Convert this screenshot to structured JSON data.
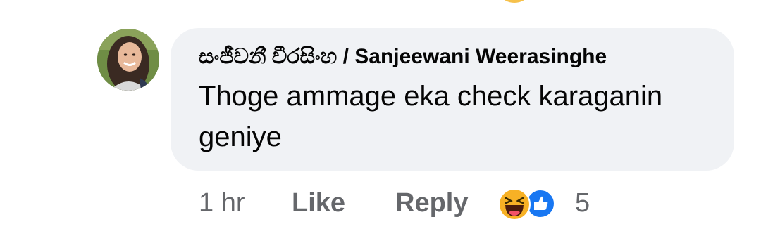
{
  "comment": {
    "author": "සංජීවනී වීරසිංහ / Sanjeewani Weerasinghe",
    "text": "Thoge ammage eka check karaganin geniye",
    "avatar_icon": "profile-photo"
  },
  "actions": {
    "time": "1 hr",
    "like_label": "Like",
    "reply_label": "Reply"
  },
  "reactions": {
    "icons": [
      "haha-reaction-icon",
      "like-reaction-icon"
    ],
    "count": "5"
  },
  "colors": {
    "bubble_bg": "#f0f2f5",
    "text_primary": "#050505",
    "text_secondary": "#65676b",
    "like_blue": "#1877f2",
    "haha_yellow": "#f7b125"
  }
}
